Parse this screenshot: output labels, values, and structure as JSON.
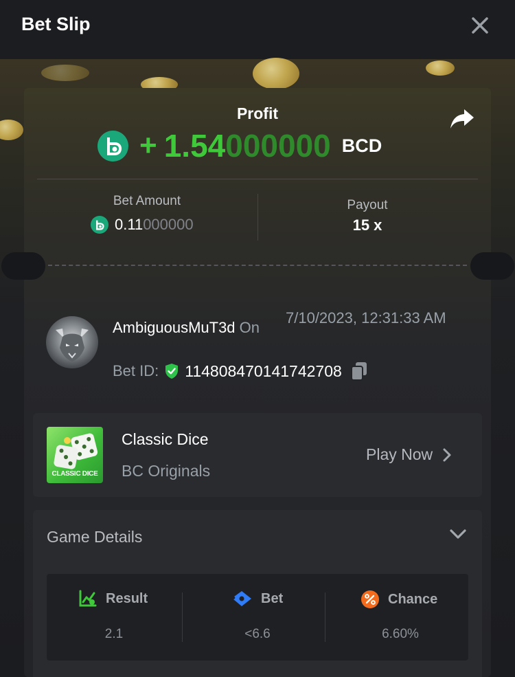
{
  "header": {
    "title": "Bet Slip"
  },
  "profit": {
    "label": "Profit",
    "sign": "+",
    "amount_significant": "1.54",
    "amount_padding": "000000",
    "currency": "BCD"
  },
  "bet_amount": {
    "label": "Bet Amount",
    "value_significant": "0.11",
    "value_padding": "000000"
  },
  "payout": {
    "label": "Payout",
    "value": "15 x"
  },
  "player": {
    "username": "AmbiguousMuT3d",
    "on_word": "On",
    "datetime": "7/10/2023, 12:31:33 AM",
    "bet_id_label": "Bet ID:",
    "bet_id": "114808470141742708"
  },
  "game": {
    "thumbnail_text": "CLASSIC DICE",
    "name": "Classic Dice",
    "provider": "BC Originals",
    "play_now": "Play Now"
  },
  "game_details": {
    "title": "Game Details",
    "stats": [
      {
        "label": "Result",
        "value": "2.1",
        "icon": "result-chart-icon",
        "icon_color": "#3fc93a"
      },
      {
        "label": "Bet",
        "value": "<6.6",
        "icon": "bet-ticket-icon",
        "icon_color": "#2f7cf6"
      },
      {
        "label": "Chance",
        "value": "6.60%",
        "icon": "chance-percent-icon",
        "icon_color": "#f36b1c"
      }
    ]
  },
  "colors": {
    "profit_green": "#3fc93a",
    "bc_coin": "#1aa87a",
    "background": "#17181b"
  }
}
